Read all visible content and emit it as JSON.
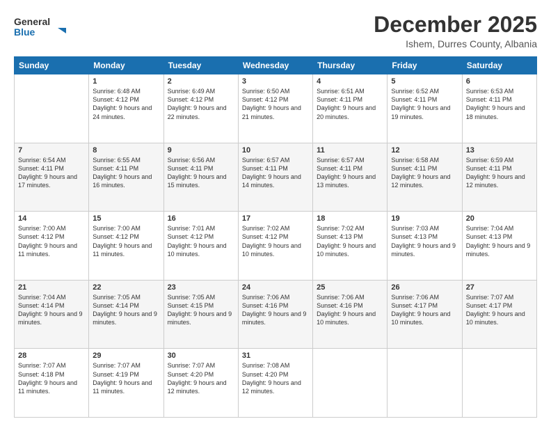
{
  "logo": {
    "general": "General",
    "blue": "Blue"
  },
  "header": {
    "month": "December 2025",
    "location": "Ishem, Durres County, Albania"
  },
  "weekdays": [
    "Sunday",
    "Monday",
    "Tuesday",
    "Wednesday",
    "Thursday",
    "Friday",
    "Saturday"
  ],
  "weeks": [
    [
      {
        "day": "",
        "sunrise": "",
        "sunset": "",
        "daylight": ""
      },
      {
        "day": "1",
        "sunrise": "Sunrise: 6:48 AM",
        "sunset": "Sunset: 4:12 PM",
        "daylight": "Daylight: 9 hours and 24 minutes."
      },
      {
        "day": "2",
        "sunrise": "Sunrise: 6:49 AM",
        "sunset": "Sunset: 4:12 PM",
        "daylight": "Daylight: 9 hours and 22 minutes."
      },
      {
        "day": "3",
        "sunrise": "Sunrise: 6:50 AM",
        "sunset": "Sunset: 4:12 PM",
        "daylight": "Daylight: 9 hours and 21 minutes."
      },
      {
        "day": "4",
        "sunrise": "Sunrise: 6:51 AM",
        "sunset": "Sunset: 4:11 PM",
        "daylight": "Daylight: 9 hours and 20 minutes."
      },
      {
        "day": "5",
        "sunrise": "Sunrise: 6:52 AM",
        "sunset": "Sunset: 4:11 PM",
        "daylight": "Daylight: 9 hours and 19 minutes."
      },
      {
        "day": "6",
        "sunrise": "Sunrise: 6:53 AM",
        "sunset": "Sunset: 4:11 PM",
        "daylight": "Daylight: 9 hours and 18 minutes."
      }
    ],
    [
      {
        "day": "7",
        "sunrise": "Sunrise: 6:54 AM",
        "sunset": "Sunset: 4:11 PM",
        "daylight": "Daylight: 9 hours and 17 minutes."
      },
      {
        "day": "8",
        "sunrise": "Sunrise: 6:55 AM",
        "sunset": "Sunset: 4:11 PM",
        "daylight": "Daylight: 9 hours and 16 minutes."
      },
      {
        "day": "9",
        "sunrise": "Sunrise: 6:56 AM",
        "sunset": "Sunset: 4:11 PM",
        "daylight": "Daylight: 9 hours and 15 minutes."
      },
      {
        "day": "10",
        "sunrise": "Sunrise: 6:57 AM",
        "sunset": "Sunset: 4:11 PM",
        "daylight": "Daylight: 9 hours and 14 minutes."
      },
      {
        "day": "11",
        "sunrise": "Sunrise: 6:57 AM",
        "sunset": "Sunset: 4:11 PM",
        "daylight": "Daylight: 9 hours and 13 minutes."
      },
      {
        "day": "12",
        "sunrise": "Sunrise: 6:58 AM",
        "sunset": "Sunset: 4:11 PM",
        "daylight": "Daylight: 9 hours and 12 minutes."
      },
      {
        "day": "13",
        "sunrise": "Sunrise: 6:59 AM",
        "sunset": "Sunset: 4:11 PM",
        "daylight": "Daylight: 9 hours and 12 minutes."
      }
    ],
    [
      {
        "day": "14",
        "sunrise": "Sunrise: 7:00 AM",
        "sunset": "Sunset: 4:12 PM",
        "daylight": "Daylight: 9 hours and 11 minutes."
      },
      {
        "day": "15",
        "sunrise": "Sunrise: 7:00 AM",
        "sunset": "Sunset: 4:12 PM",
        "daylight": "Daylight: 9 hours and 11 minutes."
      },
      {
        "day": "16",
        "sunrise": "Sunrise: 7:01 AM",
        "sunset": "Sunset: 4:12 PM",
        "daylight": "Daylight: 9 hours and 10 minutes."
      },
      {
        "day": "17",
        "sunrise": "Sunrise: 7:02 AM",
        "sunset": "Sunset: 4:12 PM",
        "daylight": "Daylight: 9 hours and 10 minutes."
      },
      {
        "day": "18",
        "sunrise": "Sunrise: 7:02 AM",
        "sunset": "Sunset: 4:13 PM",
        "daylight": "Daylight: 9 hours and 10 minutes."
      },
      {
        "day": "19",
        "sunrise": "Sunrise: 7:03 AM",
        "sunset": "Sunset: 4:13 PM",
        "daylight": "Daylight: 9 hours and 9 minutes."
      },
      {
        "day": "20",
        "sunrise": "Sunrise: 7:04 AM",
        "sunset": "Sunset: 4:13 PM",
        "daylight": "Daylight: 9 hours and 9 minutes."
      }
    ],
    [
      {
        "day": "21",
        "sunrise": "Sunrise: 7:04 AM",
        "sunset": "Sunset: 4:14 PM",
        "daylight": "Daylight: 9 hours and 9 minutes."
      },
      {
        "day": "22",
        "sunrise": "Sunrise: 7:05 AM",
        "sunset": "Sunset: 4:14 PM",
        "daylight": "Daylight: 9 hours and 9 minutes."
      },
      {
        "day": "23",
        "sunrise": "Sunrise: 7:05 AM",
        "sunset": "Sunset: 4:15 PM",
        "daylight": "Daylight: 9 hours and 9 minutes."
      },
      {
        "day": "24",
        "sunrise": "Sunrise: 7:06 AM",
        "sunset": "Sunset: 4:16 PM",
        "daylight": "Daylight: 9 hours and 9 minutes."
      },
      {
        "day": "25",
        "sunrise": "Sunrise: 7:06 AM",
        "sunset": "Sunset: 4:16 PM",
        "daylight": "Daylight: 9 hours and 10 minutes."
      },
      {
        "day": "26",
        "sunrise": "Sunrise: 7:06 AM",
        "sunset": "Sunset: 4:17 PM",
        "daylight": "Daylight: 9 hours and 10 minutes."
      },
      {
        "day": "27",
        "sunrise": "Sunrise: 7:07 AM",
        "sunset": "Sunset: 4:17 PM",
        "daylight": "Daylight: 9 hours and 10 minutes."
      }
    ],
    [
      {
        "day": "28",
        "sunrise": "Sunrise: 7:07 AM",
        "sunset": "Sunset: 4:18 PM",
        "daylight": "Daylight: 9 hours and 11 minutes."
      },
      {
        "day": "29",
        "sunrise": "Sunrise: 7:07 AM",
        "sunset": "Sunset: 4:19 PM",
        "daylight": "Daylight: 9 hours and 11 minutes."
      },
      {
        "day": "30",
        "sunrise": "Sunrise: 7:07 AM",
        "sunset": "Sunset: 4:20 PM",
        "daylight": "Daylight: 9 hours and 12 minutes."
      },
      {
        "day": "31",
        "sunrise": "Sunrise: 7:08 AM",
        "sunset": "Sunset: 4:20 PM",
        "daylight": "Daylight: 9 hours and 12 minutes."
      },
      {
        "day": "",
        "sunrise": "",
        "sunset": "",
        "daylight": ""
      },
      {
        "day": "",
        "sunrise": "",
        "sunset": "",
        "daylight": ""
      },
      {
        "day": "",
        "sunrise": "",
        "sunset": "",
        "daylight": ""
      }
    ]
  ]
}
